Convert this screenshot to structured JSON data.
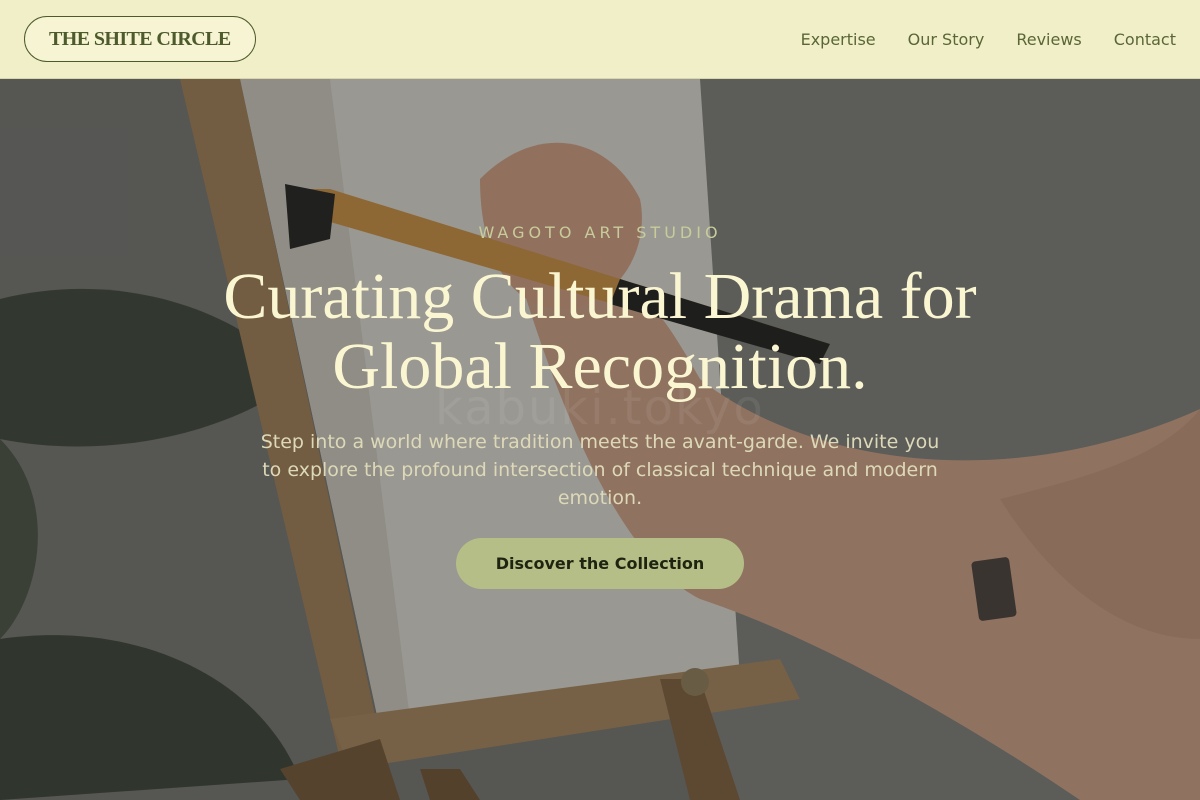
{
  "header": {
    "logo_text": "THE SHITE CIRCLE",
    "nav": [
      {
        "label": "Expertise"
      },
      {
        "label": "Our Story"
      },
      {
        "label": "Reviews"
      },
      {
        "label": "Contact"
      }
    ]
  },
  "hero": {
    "eyebrow": "WAGOTO ART STUDIO",
    "headline": "Curating Cultural Drama for Global Recognition.",
    "subtext": "Step into a world where tradition meets the avant-garde. We invite you to explore the profound intersection of classical technique and modern emotion.",
    "cta_label": "Discover the Collection",
    "watermark": "kabuki.tokyo",
    "background_image": "artist-painting-on-easel"
  },
  "colors": {
    "header_bg": "#f1efc8",
    "brand_green": "#4d5a2c",
    "headline": "#fbf6d2",
    "cta_bg": "#b6be88"
  }
}
